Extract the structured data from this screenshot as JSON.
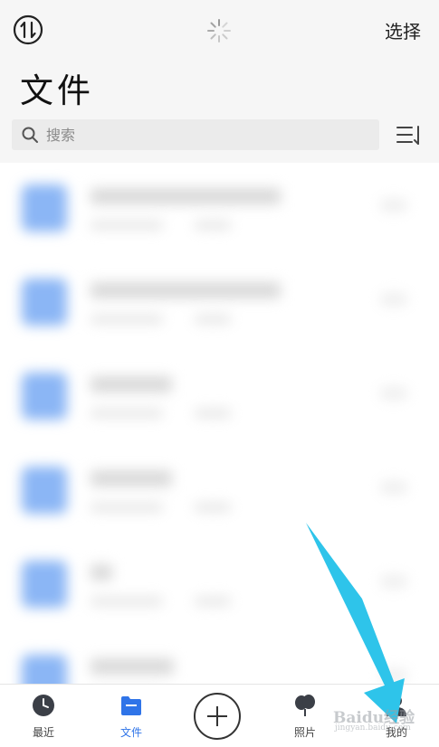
{
  "header": {
    "title": "文件",
    "select_label": "选择",
    "search": {
      "placeholder": "搜索",
      "icon": "search-icon"
    },
    "sync_icon": "sync-icon",
    "loading_icon": "loading-spinner-icon",
    "sort_icon": "sort-list-icon"
  },
  "file_list": {
    "blurred": true,
    "row_count": 6,
    "thumbnail_color": "#8bb6f5"
  },
  "tabbar": {
    "tabs": [
      {
        "label": "最近",
        "icon": "clock-icon",
        "active": false
      },
      {
        "label": "文件",
        "icon": "folder-icon",
        "active": true
      },
      {
        "label": "",
        "icon": "add-circle-icon",
        "active": false
      },
      {
        "label": "照片",
        "icon": "photos-balloon-icon",
        "active": false
      },
      {
        "label": "我的",
        "icon": "person-icon",
        "active": false
      }
    ],
    "active_color": "#2f74e8"
  },
  "annotation": {
    "arrow_color": "#2ec4ea",
    "points_to": "tab-me"
  },
  "watermark": {
    "line1": "Baidu经验",
    "line2": "jingyan.baidu.com"
  }
}
